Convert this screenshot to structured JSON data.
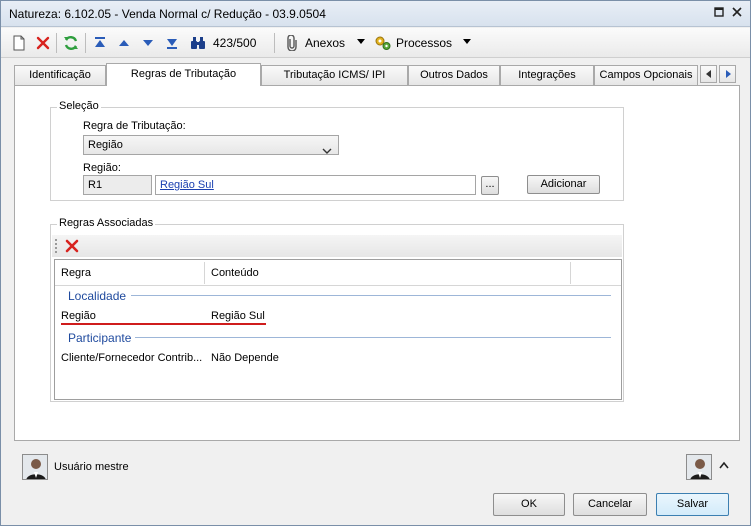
{
  "window": {
    "title": "Natureza: 6.102.05 - Venda Normal c/ Redução - 03.9.0504"
  },
  "toolbar": {
    "record_counter": "423/500",
    "anexos_label": "Anexos",
    "processos_label": "Processos"
  },
  "tabs": [
    {
      "label": "Identificação"
    },
    {
      "label": "Regras de Tributação"
    },
    {
      "label": "Tributação ICMS/ IPI"
    },
    {
      "label": "Outros Dados"
    },
    {
      "label": "Integrações"
    },
    {
      "label": "Campos Opcionais"
    }
  ],
  "selecao": {
    "group_title": "Seleção",
    "regra_label": "Regra de Tributação:",
    "regra_value": "Região",
    "regiao_label": "Região:",
    "regiao_code": "R1",
    "regiao_name": "Região Sul",
    "lookup_label": "...",
    "adicionar_label": "Adicionar"
  },
  "regras": {
    "group_title": "Regras Associadas",
    "columns": [
      "Regra",
      "Conteúdo"
    ],
    "groups": [
      {
        "title": "Localidade",
        "rows": [
          {
            "regra": "Região",
            "conteudo": "Região Sul"
          }
        ]
      },
      {
        "title": "Participante",
        "rows": [
          {
            "regra": "Cliente/Fornecedor Contrib...",
            "conteudo": "Não Depende"
          }
        ]
      }
    ]
  },
  "status": {
    "user_label": "Usuário mestre"
  },
  "footer": {
    "ok_label": "OK",
    "cancel_label": "Cancelar",
    "save_label": "Salvar"
  },
  "colors": {
    "accent_blue": "#1f4a9e",
    "highlight_red": "#cf1c1c",
    "refresh_green": "#2e9e3e",
    "delete_red": "#d8231f"
  }
}
